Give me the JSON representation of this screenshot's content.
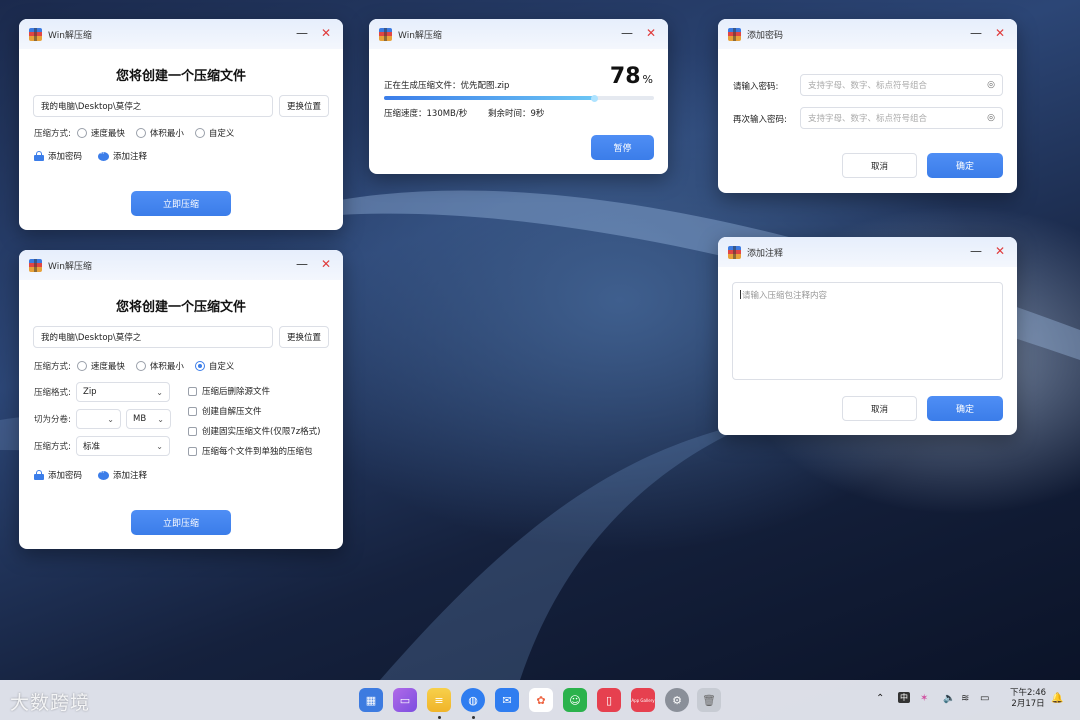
{
  "win1": {
    "title": "Win解压缩",
    "heading": "您将创建一个压缩文件",
    "path_value": "我的电脑\\Desktop\\莫停之",
    "change_location_label": "更换位置",
    "mode_label": "压缩方式:",
    "mode_options": [
      "速度最快",
      "体积最小",
      "自定义"
    ],
    "mode_selected": "",
    "add_password_label": "添加密码",
    "add_comment_label": "添加注释",
    "compress_now_label": "立即压缩"
  },
  "win2": {
    "title": "Win解压缩",
    "heading": "您将创建一个压缩文件",
    "path_value": "我的电脑\\Desktop\\莫停之",
    "change_location_label": "更换位置",
    "mode_label": "压缩方式:",
    "mode_options": [
      "速度最快",
      "体积最小",
      "自定义"
    ],
    "mode_selected": "自定义",
    "format_label": "压缩格式:",
    "format_value": "Zip",
    "split_label": "切为分卷:",
    "split_value": "",
    "split_unit": "MB",
    "level_label": "压缩方式:",
    "level_value": "标准",
    "checkboxes": [
      "压缩后删除源文件",
      "创建自解压文件",
      "创建固实压缩文件(仅限7z格式)",
      "压缩每个文件到单独的压缩包"
    ],
    "add_password_label": "添加密码",
    "add_comment_label": "添加注释",
    "compress_now_label": "立即压缩"
  },
  "win3": {
    "title": "Win解压缩",
    "status_text": "正在生成压缩文件：优先配图.zip",
    "percent": "78",
    "percent_sign": "%",
    "progress": 0.78,
    "speed_text": "压缩速度：130MB/秒",
    "remaining_text": "剩余时间：9秒",
    "pause_label": "暂停"
  },
  "win4": {
    "title": "添加密码",
    "password_label": "请输入密码:",
    "password_placeholder": "支持字母、数字、标点符号组合",
    "confirm_label": "再次输入密码:",
    "confirm_placeholder": "支持字母、数字、标点符号组合",
    "cancel_label": "取消",
    "ok_label": "确定"
  },
  "win5": {
    "title": "添加注释",
    "comment_placeholder": "请输入压缩包注释内容",
    "cancel_label": "取消",
    "ok_label": "确定"
  },
  "taskbar": {
    "watermark": "大数跨境",
    "dock_icons": [
      "app-grid-icon",
      "files-icon",
      "notes-icon",
      "browser-icon",
      "mail-icon",
      "gallery-icon",
      "messages-icon",
      "books-icon",
      "app-gallery-icon",
      "settings-icon",
      "trash-icon"
    ],
    "app_gallery_label": "App Gallery",
    "ime_label": "中",
    "time": "下午2:46",
    "date": "2月17日",
    "colors": {
      "accent": "#3b7de9",
      "close": "#e03b3b"
    }
  }
}
